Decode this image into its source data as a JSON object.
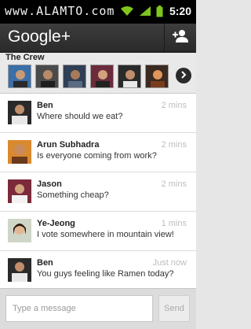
{
  "status_bar": {
    "watermark": "www.ALAMTO.com",
    "time": "5:20",
    "icons": [
      "wifi-icon",
      "signal-icon",
      "battery-icon"
    ]
  },
  "app_bar": {
    "title": "Google+",
    "action_icon": "add-person-icon"
  },
  "circle": {
    "title": "The Crew",
    "members_shown": 6,
    "next_icon": "chevron-right-icon"
  },
  "messages": [
    {
      "name": "Ben",
      "time": "2 mins",
      "text": "Where should we eat?"
    },
    {
      "name": "Arun Subhadra",
      "time": "2 mins",
      "text": "Is everyone coming from work?"
    },
    {
      "name": "Jason",
      "time": "2 mins",
      "text": "Something cheap?"
    },
    {
      "name": "Ye-Jeong",
      "time": "1 mins",
      "text": "I vote somewhere in mountain view!"
    },
    {
      "name": "Ben",
      "time": "Just now",
      "text": "You guys feeling like Ramen today?"
    }
  ],
  "composer": {
    "placeholder": "Type a message",
    "value": "",
    "send_label": "Send"
  },
  "colors": {
    "app_bar": "#2e2e2e",
    "timestamp": "#bdbdbd",
    "status_icon_green": "#7ec61e"
  }
}
